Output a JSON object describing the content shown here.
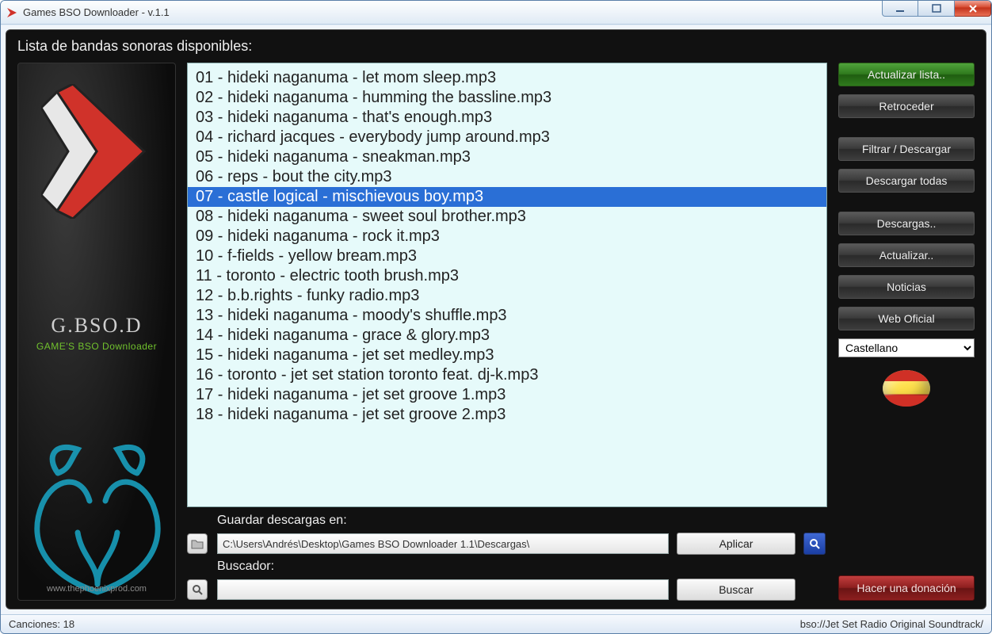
{
  "window": {
    "title": "Games BSO Downloader - v.1.1"
  },
  "header": {
    "label": "Lista de bandas sonoras disponibles:"
  },
  "logo": {
    "brand": "G.BSO.D",
    "brand_sub": "GAME'S BSO Downloader",
    "site": "www.thephoenixprod.com"
  },
  "tracks": {
    "selected_index": 6,
    "items": [
      "01 - hideki naganuma - let mom sleep.mp3",
      "02 - hideki naganuma - humming the bassline.mp3",
      "03 - hideki naganuma - that's enough.mp3",
      "04 - richard jacques - everybody jump around.mp3",
      "05 - hideki naganuma - sneakman.mp3",
      "06 - reps - bout the city.mp3",
      "07 - castle logical - mischievous boy.mp3",
      "08 - hideki naganuma - sweet soul brother.mp3",
      "09 - hideki naganuma - rock it.mp3",
      "10 - f-fields - yellow bream.mp3",
      "11 - toronto - electric tooth brush.mp3",
      "12 - b.b.rights - funky radio.mp3",
      "13 - hideki naganuma - moody's shuffle.mp3",
      "14 - hideki naganuma - grace & glory.mp3",
      "15 - hideki naganuma - jet set medley.mp3",
      "16 - toronto - jet set station   toronto feat. dj-k.mp3",
      "17 - hideki naganuma - jet set groove 1.mp3",
      "18 - hideki naganuma - jet set groove 2.mp3"
    ]
  },
  "save": {
    "label": "Guardar descargas en:",
    "path": "C:\\Users\\Andrés\\Desktop\\Games BSO Downloader 1.1\\Descargas\\",
    "apply": "Aplicar"
  },
  "search": {
    "label": "Buscador:",
    "value": "",
    "submit": "Buscar"
  },
  "sidebar": {
    "update_list": "Actualizar lista..",
    "back": "Retroceder",
    "filter_download": "Filtrar / Descargar",
    "download_all": "Descargar todas",
    "downloads": "Descargas..",
    "update": "Actualizar..",
    "news": "Noticias",
    "website": "Web Oficial",
    "language": "Castellano",
    "donate": "Hacer una donación"
  },
  "status": {
    "left_label": "Canciones:",
    "count": "18",
    "right": "bso://Jet Set Radio Original Soundtrack/"
  }
}
